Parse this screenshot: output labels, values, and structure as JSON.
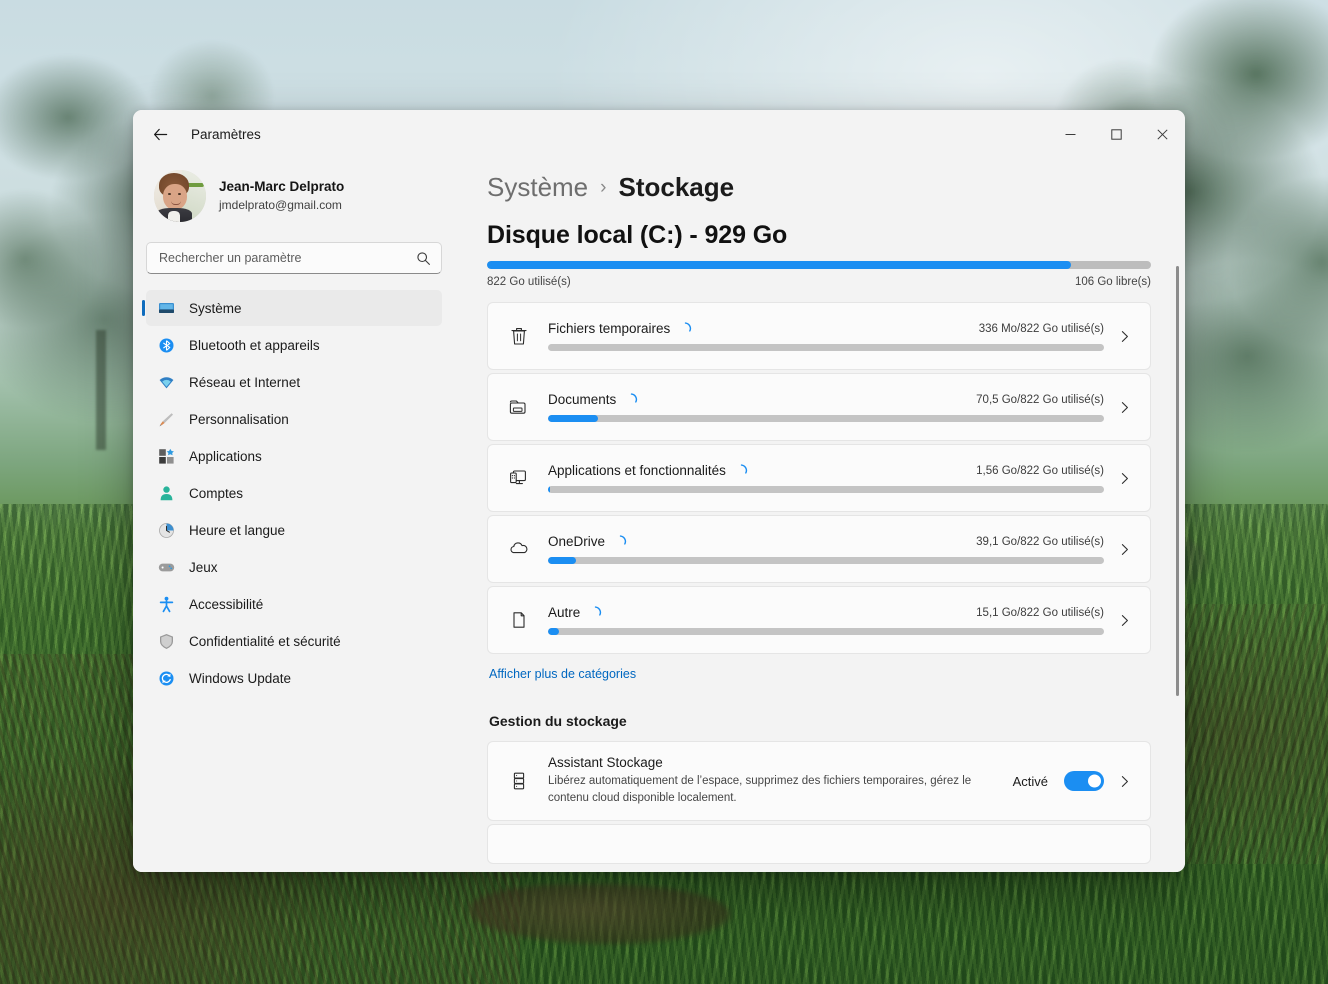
{
  "window": {
    "app_title": "Paramètres",
    "back_icon": "back-arrow-icon",
    "minimize_label": "minimize-icon",
    "maximize_label": "maximize-icon",
    "close_label": "close-icon"
  },
  "sidebar": {
    "profile": {
      "name": "Jean-Marc Delprato",
      "email": "jmdelprato@gmail.com"
    },
    "search": {
      "placeholder": "Rechercher un paramètre",
      "value": "",
      "icon": "search-icon"
    },
    "items": [
      {
        "label": "Système",
        "icon": "monitor-icon",
        "active": true
      },
      {
        "label": "Bluetooth et appareils",
        "icon": "bluetooth-icon",
        "active": false
      },
      {
        "label": "Réseau et Internet",
        "icon": "wifi-icon",
        "active": false
      },
      {
        "label": "Personnalisation",
        "icon": "paintbrush-icon",
        "active": false
      },
      {
        "label": "Applications",
        "icon": "apps-icon",
        "active": false
      },
      {
        "label": "Comptes",
        "icon": "person-icon",
        "active": false
      },
      {
        "label": "Heure et langue",
        "icon": "clock-icon",
        "active": false
      },
      {
        "label": "Jeux",
        "icon": "gamepad-icon",
        "active": false
      },
      {
        "label": "Accessibilité",
        "icon": "accessibility-icon",
        "active": false
      },
      {
        "label": "Confidentialité et sécurité",
        "icon": "shield-icon",
        "active": false
      },
      {
        "label": "Windows Update",
        "icon": "update-icon",
        "active": false
      }
    ]
  },
  "main": {
    "breadcrumb": {
      "parent": "Système",
      "separator": "›",
      "current": "Stockage"
    },
    "disk": {
      "title": "Disque local (C:) - 929 Go",
      "used_label": "822 Go utilisé(s)",
      "free_label": "106 Go libre(s)",
      "used_percent": 88
    },
    "categories": [
      {
        "label": "Fichiers temporaires",
        "icon": "trash-icon",
        "amount": "336 Mo/822 Go utilisé(s)",
        "percent": 0,
        "loading": true
      },
      {
        "label": "Documents",
        "icon": "folder-icon",
        "amount": "70,5 Go/822 Go utilisé(s)",
        "percent": 9,
        "loading": true
      },
      {
        "label": "Applications et fonctionnalités",
        "icon": "apps-monitor-icon",
        "amount": "1,56 Go/822 Go utilisé(s)",
        "percent": 0.4,
        "loading": true
      },
      {
        "label": "OneDrive",
        "icon": "cloud-icon",
        "amount": "39,1 Go/822 Go utilisé(s)",
        "percent": 5,
        "loading": true
      },
      {
        "label": "Autre",
        "icon": "document-icon",
        "amount": "15,1 Go/822 Go utilisé(s)",
        "percent": 2,
        "loading": true
      }
    ],
    "more_link": "Afficher plus de catégories",
    "management_section_title": "Gestion du stockage",
    "storage_sense": {
      "icon": "storage-stack-icon",
      "title": "Assistant Stockage",
      "description": "Libérez automatiquement de l’espace, supprimez des fichiers temporaires, gérez le contenu cloud disponible localement.",
      "toggle_label": "Activé",
      "toggle_on": true
    }
  },
  "colors": {
    "accent": "#1b8ef2",
    "link": "#0067c0",
    "selection_bar": "#0f6cbd",
    "window_bg": "#f3f3f3",
    "card_bg": "#fbfbfb"
  }
}
